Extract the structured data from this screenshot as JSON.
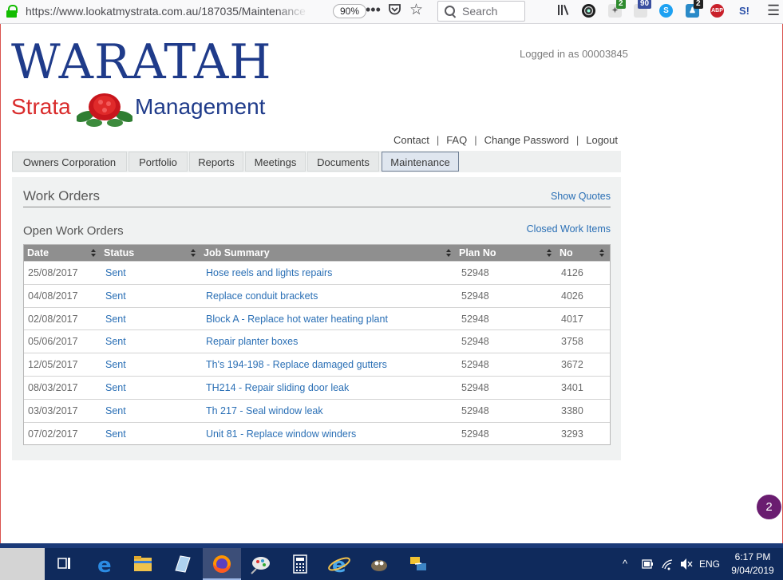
{
  "browser": {
    "url": "https://www.lookatmystrata.com.au/187035/Maintenance",
    "zoom": "90%",
    "search_placeholder": "Search",
    "ext_badges": {
      "green": "2",
      "blue": "90",
      "dark": "2"
    },
    "abp_label": "ABP",
    "s_label": "S!"
  },
  "header": {
    "logo_main": "WARATAH",
    "logo_left": "Strata",
    "logo_right": "Management",
    "logged_in": "Logged in as 00003845",
    "links": [
      "Contact",
      "FAQ",
      "Change Password",
      "Logout"
    ]
  },
  "nav": {
    "tabs": [
      "Owners Corporation",
      "Portfolio",
      "Reports",
      "Meetings",
      "Documents",
      "Maintenance"
    ],
    "active_tab": "Maintenance"
  },
  "main": {
    "title": "Work Orders",
    "show_quotes": "Show Quotes",
    "open_title": "Open Work Orders",
    "closed_link": "Closed Work Items",
    "columns": [
      "Date",
      "Status",
      "Job Summary",
      "Plan No",
      "No"
    ],
    "rows": [
      [
        "25/08/2017",
        "Sent",
        "Hose reels and lights repairs",
        "52948",
        "4126"
      ],
      [
        "04/08/2017",
        "Sent",
        "Replace conduit brackets",
        "52948",
        "4026"
      ],
      [
        "02/08/2017",
        "Sent",
        "Block A - Replace hot water heating plant",
        "52948",
        "4017"
      ],
      [
        "05/06/2017",
        "Sent",
        "Repair planter boxes",
        "52948",
        "3758"
      ],
      [
        "12/05/2017",
        "Sent",
        "Th's 194-198 - Replace damaged gutters",
        "52948",
        "3672"
      ],
      [
        "08/03/2017",
        "Sent",
        "TH214 - Repair sliding door leak",
        "52948",
        "3401"
      ],
      [
        "03/03/2017",
        "Sent",
        "Th 217 - Seal window leak",
        "52948",
        "3380"
      ],
      [
        "07/02/2017",
        "Sent",
        "Unit 81 - Replace window winders",
        "52948",
        "3293"
      ]
    ]
  },
  "chat": {
    "count": "2"
  },
  "taskbar": {
    "language": "ENG",
    "time": "6:17 PM",
    "date": "9/04/2019"
  },
  "colors": {
    "brand_blue": "#1f3b8a",
    "brand_red": "#d92b2b",
    "link": "#2a6fb5",
    "table_header": "#8f8f8f",
    "chat": "#6a1d70"
  }
}
